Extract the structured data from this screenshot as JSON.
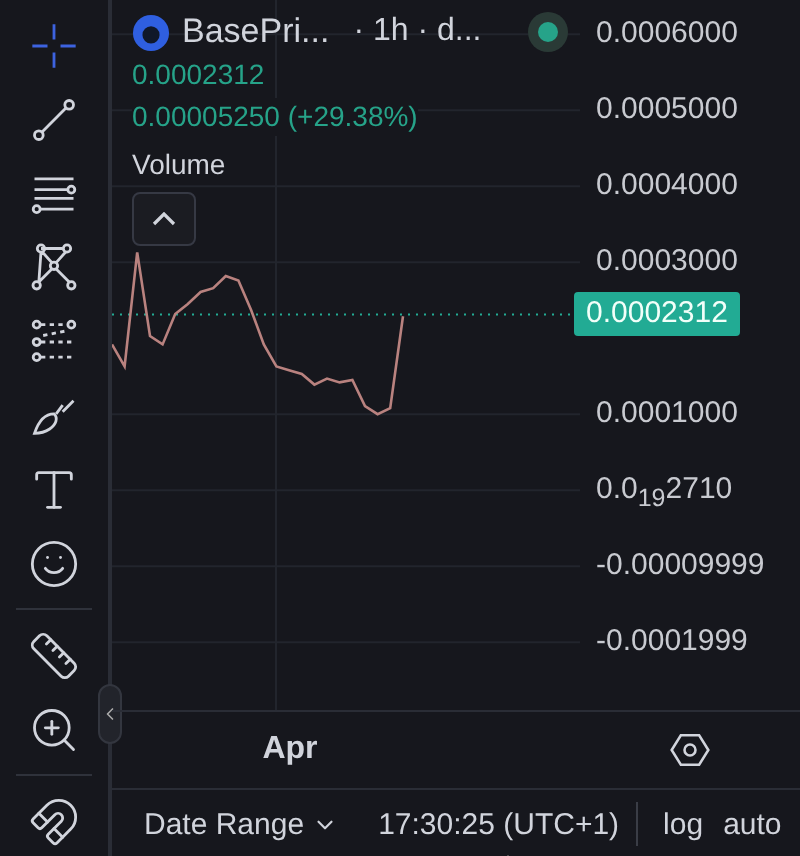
{
  "toolbar": {
    "tool_groups": [
      [
        {
          "kind": "crosshair",
          "selected": true
        },
        {
          "kind": "trend-line",
          "selected": false
        },
        {
          "kind": "horizontal-lines",
          "selected": false
        },
        {
          "kind": "pattern",
          "selected": false
        },
        {
          "kind": "fib",
          "selected": false
        },
        {
          "kind": "brush",
          "selected": false
        },
        {
          "kind": "text",
          "selected": false
        },
        {
          "kind": "emoji",
          "selected": false
        }
      ],
      [
        {
          "kind": "ruler",
          "selected": false
        },
        {
          "kind": "zoom",
          "selected": false
        }
      ],
      [
        {
          "kind": "magnet",
          "selected": false
        }
      ]
    ]
  },
  "legend": {
    "symbol": "BasePri...",
    "interval": "· 1h · d...",
    "market_open": true,
    "price": "0.0002312",
    "change": "0.00005250 (+29.38%)"
  },
  "volume": {
    "label": "Volume"
  },
  "chart": {
    "chart_data": {
      "type": "line",
      "grid": true,
      "ylim": [
        -0.000289,
        0.000645
      ],
      "annotations": [
        "Apr"
      ],
      "ref_lines": [
        {
          "axis": "y",
          "value": 0.0002312,
          "label": "0.0002312",
          "color": "#22ab94"
        }
      ],
      "yticks": [
        {
          "value": 0.0006,
          "label": "0.0006000"
        },
        {
          "value": 0.0005,
          "label": "0.0005000"
        },
        {
          "value": 0.0004,
          "label": "0.0004000"
        },
        {
          "value": 0.0003,
          "label": "0.0003000"
        },
        {
          "value": 0.0001,
          "label": "0.0001000"
        },
        {
          "value": 0,
          "label": "0.0$_{19}$2710"
        },
        {
          "value": -9.999e-05,
          "label": "-0.00009999"
        },
        {
          "value": -0.0001999,
          "label": "-0.0001999"
        }
      ],
      "series": [
        {
          "color": "#b9827f",
          "values": [
            0.000192,
            0.000163,
            0.000313,
            0.000203,
            0.000192,
            0.000232,
            0.000245,
            0.000261,
            0.000266,
            0.000282,
            0.000276,
            0.000237,
            0.000192,
            0.000163,
            0.000158,
            0.000153,
            0.000139,
            0.000147,
            0.000142,
            0.000145,
            0.000111,
            0.0001,
            0.000108,
            0.000229,
            null,
            null,
            null,
            null,
            null,
            null,
            null,
            null,
            null,
            null,
            null,
            null,
            null,
            null
          ]
        }
      ]
    }
  },
  "bottom_bar": {
    "date_range": "Date Range",
    "time": "17:30:25 (UTC+1)",
    "scale_buttons": [
      "log",
      "auto"
    ]
  }
}
